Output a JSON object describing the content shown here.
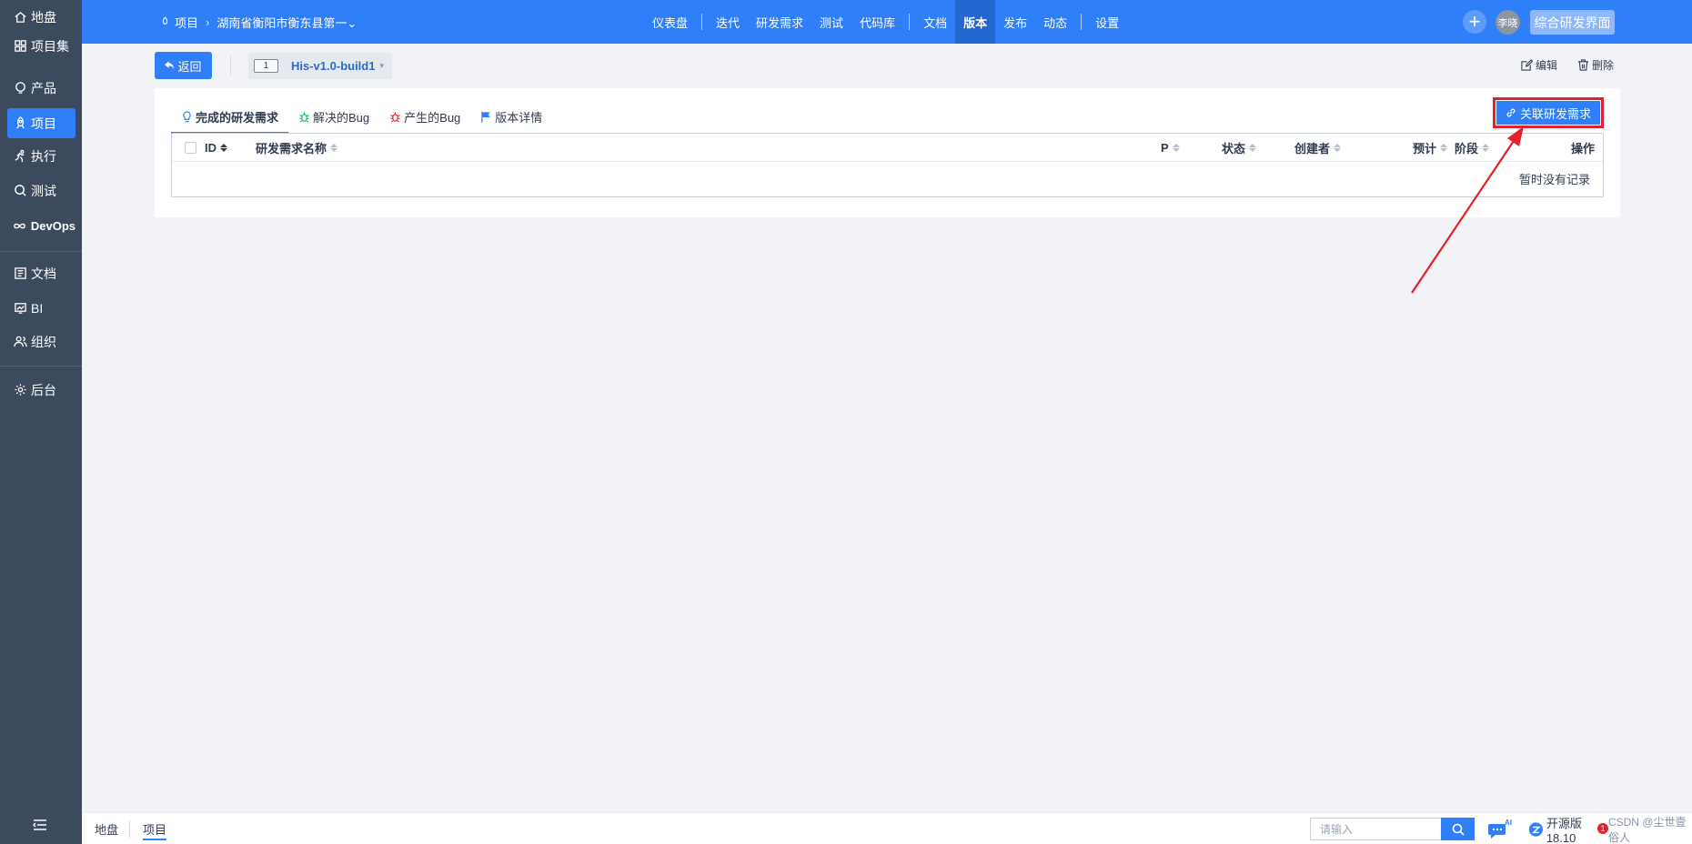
{
  "sidebar": {
    "items": [
      {
        "label": "地盘",
        "icon": "home-icon"
      },
      {
        "label": "项目集",
        "icon": "grid-icon"
      },
      {
        "label": "产品",
        "icon": "bulb-icon"
      },
      {
        "label": "项目",
        "icon": "rocket-icon"
      },
      {
        "label": "执行",
        "icon": "run-icon"
      },
      {
        "label": "测试",
        "icon": "search-bug-icon"
      },
      {
        "label": "DevOps",
        "icon": "infinity-icon"
      },
      {
        "label": "文档",
        "icon": "doc-icon"
      },
      {
        "label": "BI",
        "icon": "chart-monitor-icon"
      },
      {
        "label": "组织",
        "icon": "people-icon"
      },
      {
        "label": "后台",
        "icon": "gear-icon"
      }
    ],
    "active_index": 3
  },
  "header": {
    "breadcrumb_root": "项目",
    "breadcrumb_project": "湖南省衡阳市衡东县第一⌄",
    "nav": [
      {
        "label": "仪表盘"
      },
      {
        "label": "迭代"
      },
      {
        "label": "研发需求"
      },
      {
        "label": "测试"
      },
      {
        "label": "代码库"
      },
      {
        "label": "文档"
      },
      {
        "label": "版本"
      },
      {
        "label": "发布"
      },
      {
        "label": "动态"
      },
      {
        "label": "设置"
      }
    ],
    "active_nav": "版本",
    "plus_label": "+",
    "avatar_label": "李晓",
    "overview_label": "综合研发界面"
  },
  "toolbar": {
    "back_label": "返回",
    "build_number": "1",
    "build_name": "His-v1.0-build1",
    "edit_label": "编辑",
    "delete_label": "删除"
  },
  "tabs": [
    {
      "label": "完成的研发需求",
      "icon": "bulb-icon",
      "icon_color": "#2e7ff8"
    },
    {
      "label": "解决的Bug",
      "icon": "bug-icon",
      "icon_color": "#17b26a"
    },
    {
      "label": "产生的Bug",
      "icon": "bug-icon",
      "icon_color": "#e5202a"
    },
    {
      "label": "版本详情",
      "icon": "flag-icon",
      "icon_color": "#2e7ff8"
    }
  ],
  "link_button_label": "关联研发需求",
  "table": {
    "columns": {
      "id": "ID",
      "name": "研发需求名称",
      "priority": "P",
      "status": "状态",
      "creator": "创建者",
      "estimate": "预计",
      "stage": "阶段",
      "actions": "操作"
    },
    "empty_text": "暂时没有记录"
  },
  "footer": {
    "breadcrumb_home": "地盘",
    "breadcrumb_current": "项目",
    "search_placeholder": "请输入",
    "ai_label": "AI",
    "brand_text": "开源版18.10",
    "watermark": "CSDN @尘世壹俗人",
    "badge": "1"
  },
  "colors": {
    "accent": "#2e7ff8",
    "sidebar_bg": "#3c4a5e",
    "annotation_red": "#e5202a"
  }
}
